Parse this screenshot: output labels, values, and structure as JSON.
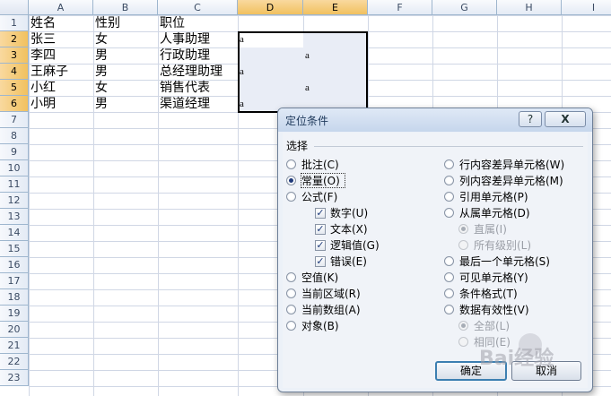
{
  "columns": [
    "A",
    "B",
    "C",
    "D",
    "E",
    "F",
    "G",
    "H",
    "I"
  ],
  "rows": [
    "1",
    "2",
    "3",
    "4",
    "5",
    "6",
    "7",
    "8",
    "9",
    "10",
    "11",
    "12",
    "13",
    "14",
    "15",
    "16",
    "17",
    "18",
    "19",
    "20",
    "21",
    "22",
    "23"
  ],
  "cells": {
    "r1": [
      "姓名",
      "性别",
      "职位"
    ],
    "r2": [
      "张三",
      "女",
      "人事助理",
      "a",
      ""
    ],
    "r3": [
      "李四",
      "男",
      "行政助理",
      "",
      "a"
    ],
    "r4": [
      "王麻子",
      "男",
      "总经理助理",
      "a",
      ""
    ],
    "r5": [
      "小红",
      "女",
      "销售代表",
      "",
      "a"
    ],
    "r6": [
      "小明",
      "男",
      "渠道经理",
      "a",
      ""
    ]
  },
  "dialog": {
    "title": "定位条件",
    "help_label": "?",
    "close_label": "X",
    "group_label": "选择",
    "left_options": [
      {
        "label": "批注(C)",
        "selected": false
      },
      {
        "label": "常量(O)",
        "selected": true
      },
      {
        "label": "公式(F)",
        "selected": false
      }
    ],
    "checks": [
      {
        "label": "数字(U)",
        "checked": true
      },
      {
        "label": "文本(X)",
        "checked": true
      },
      {
        "label": "逻辑值(G)",
        "checked": true
      },
      {
        "label": "错误(E)",
        "checked": true
      }
    ],
    "left_options_2": [
      {
        "label": "空值(K)",
        "selected": false
      },
      {
        "label": "当前区域(R)",
        "selected": false
      },
      {
        "label": "当前数组(A)",
        "selected": false
      },
      {
        "label": "对象(B)",
        "selected": false
      }
    ],
    "right_options": [
      {
        "label": "行内容差异单元格(W)",
        "selected": false
      },
      {
        "label": "列内容差异单元格(M)",
        "selected": false
      },
      {
        "label": "引用单元格(P)",
        "selected": false
      },
      {
        "label": "从属单元格(D)",
        "selected": false
      }
    ],
    "dependents_sub": [
      {
        "label": "直属(I)",
        "selected": true
      },
      {
        "label": "所有级别(L)",
        "selected": false
      }
    ],
    "right_options_2": [
      {
        "label": "最后一个单元格(S)",
        "selected": false
      },
      {
        "label": "可见单元格(Y)",
        "selected": false
      },
      {
        "label": "条件格式(T)",
        "selected": false
      },
      {
        "label": "数据有效性(V)",
        "selected": false
      }
    ],
    "validation_sub": [
      {
        "label": "全部(L)",
        "selected": true
      },
      {
        "label": "相同(E)",
        "selected": false
      }
    ],
    "ok_label": "确定",
    "cancel_label": "取消"
  },
  "watermark": "Bai经验"
}
